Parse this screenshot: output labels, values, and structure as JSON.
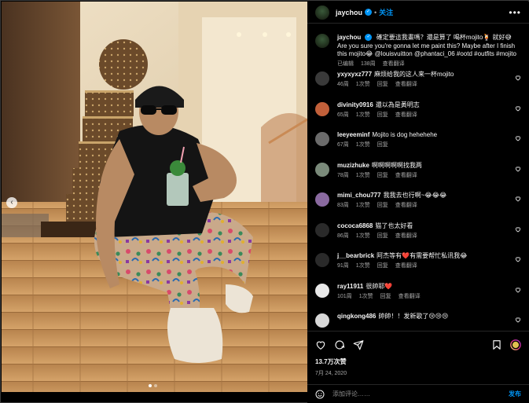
{
  "header": {
    "username": "jaychou",
    "separator": "•",
    "follow_label": "关注",
    "more_label": "•••",
    "avatar_icon": "user-avatar",
    "verified_icon": "verified-badge-icon"
  },
  "caption": {
    "username": "jaychou",
    "text": "確定要這我畫嗎？還是算了 喝杯mojito🍹 就好😅 Are you sure you're gonna let me paint this? Maybe after I finish this mojito😂 @louisvuitton @phantaci_06 #ootd #outfits #mojito",
    "edited": "已编辑",
    "time": "138周",
    "translate": "查看翻译"
  },
  "comments": [
    {
      "user": "yxyxyxz777",
      "text": "麻烦给我的这人来一杯mojito",
      "time": "46周",
      "likes": "1次赞",
      "reply": "回复",
      "translate": "查看翻译",
      "avatar_color": "#3a3a3a"
    },
    {
      "user": "divinity0916",
      "text": "還以為是黃明志",
      "time": "65周",
      "likes": "1次赞",
      "reply": "回复",
      "translate": "查看翻译",
      "avatar_color": "#c2603a"
    },
    {
      "user": "leeyeeminf",
      "text": "Mojito is dog hehehehe",
      "time": "67周",
      "likes": "1次赞",
      "reply": "回复",
      "translate": "",
      "avatar_color": "#6b6b6b"
    },
    {
      "user": "muzizhuke",
      "text": "啊啊啊啊啊找我两",
      "time": "78周",
      "likes": "1次赞",
      "reply": "回复",
      "translate": "查看翻译",
      "avatar_color": "#7a8a7a"
    },
    {
      "user": "mimi_chou777",
      "text": "我我去也行啊~😂😂😂",
      "time": "83周",
      "likes": "1次赞",
      "reply": "回复",
      "translate": "查看翻译",
      "avatar_color": "#8a6aa0"
    },
    {
      "user": "cococa6868",
      "text": "猫了也太好看",
      "time": "86周",
      "likes": "1次赞",
      "reply": "回复",
      "translate": "查看翻译",
      "avatar_color": "#2a2a2a"
    },
    {
      "user": "j__bearbrick",
      "text": "阿杰等有❤️有需要帮忙私讯我😂",
      "time": "91周",
      "likes": "1次赞",
      "reply": "回复",
      "translate": "查看翻译",
      "avatar_color": "#2a2a2a"
    },
    {
      "user": "ray11911",
      "text": "很帥耶❤️",
      "time": "101周",
      "likes": "1次赞",
      "reply": "回复",
      "translate": "查看翻译",
      "avatar_color": "#e8e8e8"
    },
    {
      "user": "qingkong486",
      "text": "帥帥！！发新歌了😢😢😢",
      "time": "",
      "likes": "",
      "reply": "",
      "translate": "",
      "avatar_color": "#d8d8d8"
    }
  ],
  "footer": {
    "likes": "13.7万次赞",
    "date": "7月 24, 2020",
    "comment_placeholder": "添加评论……",
    "post_label": "发布"
  },
  "icons": {
    "like": "heart-icon",
    "comment": "comment-icon",
    "share": "share-icon",
    "save": "bookmark-icon",
    "emoji": "emoji-icon",
    "prev": "chevron-left-icon"
  },
  "carousel": {
    "prev_label": "‹",
    "slides": 2,
    "active": 0
  }
}
